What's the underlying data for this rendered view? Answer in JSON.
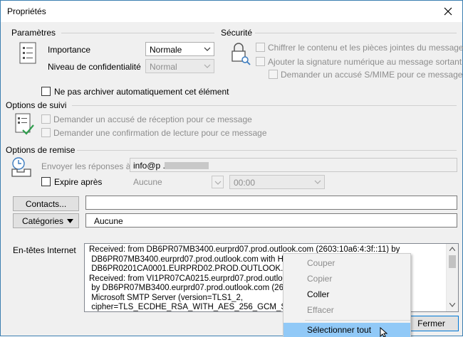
{
  "window": {
    "title": "Propriétés"
  },
  "parametres": {
    "heading": "Paramètres",
    "importance_label": "Importance",
    "importance_value": "Normale",
    "confidentiality_label": "Niveau de confidentialité",
    "confidentiality_value": "Normal",
    "no_archive_label": "Ne pas archiver automatiquement cet élément"
  },
  "securite": {
    "heading": "Sécurité",
    "encrypt_label": "Chiffrer le contenu et les pièces jointes du message",
    "signature_label": "Ajouter la signature numérique au message sortant",
    "smime_label": "Demander un accusé S/MIME pour ce message"
  },
  "suivi": {
    "heading": "Options de suivi",
    "delivery_receipt_label": "Demander un accusé de réception pour ce message",
    "read_receipt_label": "Demander une confirmation de lecture pour ce message"
  },
  "remise": {
    "heading": "Options de remise",
    "reply_to_label": "Envoyer les réponses à",
    "reply_to_value": "info@p                    .be",
    "expire_label": "Expire après",
    "expire_date": "Aucune",
    "expire_time": "00:00"
  },
  "contacts": {
    "button": "Contacts...",
    "value": ""
  },
  "categories": {
    "button": "Catégories",
    "value": "Aucune"
  },
  "headers": {
    "label": "En-têtes Internet",
    "lines": [
      "Received: from DB6PR07MB3400.eurprd07.prod.outlook.com (2603:10a6:4:3f::11) by",
      " DB6PR07MB3400.eurprd07.prod.outlook.com with H",
      " DB6PR0201CA0001.EURPRD02.PROD.OUTLOOK.COM",
      "Received: from VI1PR07CA0215.eurprd07.prod.outlook.com",
      " by DB6PR07MB3400.eurprd07.prod.outlook.com (260",
      " Microsoft SMTP Server (version=TLS1_2,",
      " cipher=TLS_ECDHE_RSA_WITH_AES_256_GCM_SHA38"
    ]
  },
  "close_button": "Fermer",
  "context_menu": {
    "items": [
      "Couper",
      "Copier",
      "Coller",
      "Effacer",
      "Sélectionner tout"
    ]
  },
  "colors": {
    "accent": "#3c7fb1",
    "highlight": "#91c9f7",
    "green_check": "#2e9e4c"
  }
}
